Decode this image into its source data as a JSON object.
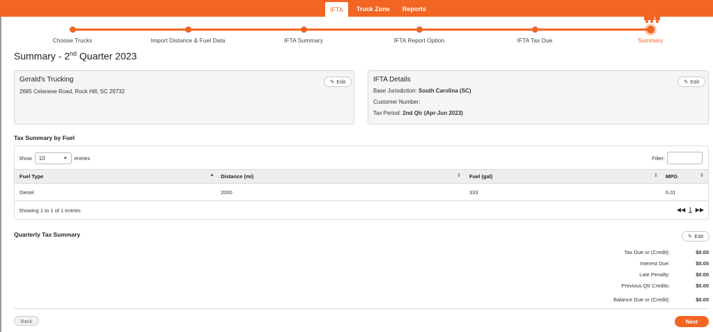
{
  "colors": {
    "accent": "#f26522",
    "card_bg": "#f5f5f5"
  },
  "nav": {
    "tabs": [
      {
        "label": "IFTA",
        "active": true
      },
      {
        "label": "Truck Zone",
        "active": false
      },
      {
        "label": "Reports",
        "active": false
      }
    ]
  },
  "stepper": {
    "steps": [
      "Choose Trucks",
      "Import Distance & Fuel Data",
      "IFTA Summary",
      "IFTA Report Option",
      "IFTA Tax Due",
      "Summary"
    ],
    "current": "Summary",
    "indicator_icon": "truck-icon"
  },
  "page": {
    "title_prefix": "Summary - 2",
    "title_sup": "nd",
    "title_suffix": " Quarter 2023"
  },
  "company": {
    "name": "Gerald's Trucking",
    "address": "2685 Celanese Road, Rock Hill, SC 29732",
    "edit_label": "Edit"
  },
  "ifta_details": {
    "title": "IFTA Details",
    "base_label": "Base Jurisdiction:",
    "base_value": "South Carolina (SC)",
    "customer_label": "Customer Number:",
    "period_label": "Tax Period:",
    "period_value": "2nd Qtr (Apr-Jun 2023)",
    "edit_label": "Edit"
  },
  "tax_by_fuel": {
    "title": "Tax Summary by Fuel",
    "show_label": "Show",
    "entries_value": "10",
    "entries_label": "entries",
    "filter_label": "Filter:",
    "columns": [
      "Fuel Type",
      "Distance (mi)",
      "Fuel (gal)",
      "MPG"
    ],
    "rows": [
      [
        "Diesel",
        "2000",
        "333",
        "6.01"
      ]
    ],
    "footer": "Showing 1 to 1 of 1 entries",
    "page": "1"
  },
  "quarterly": {
    "title": "Quarterly Tax Summary",
    "edit_label": "Edit",
    "rows": [
      {
        "label": "Tax Due or (Credit):",
        "value": "$0.00"
      },
      {
        "label": "Interest Due:",
        "value": "$0.00"
      },
      {
        "label": "Late Penalty:",
        "value": "$0.00"
      },
      {
        "label": "Previous Qtr Credits:",
        "value": "$0.00"
      },
      {
        "label": "Balance Due or (Credit):",
        "value": "$0.00"
      }
    ]
  },
  "footer": {
    "back_label": "Back",
    "next_label": "Next"
  }
}
